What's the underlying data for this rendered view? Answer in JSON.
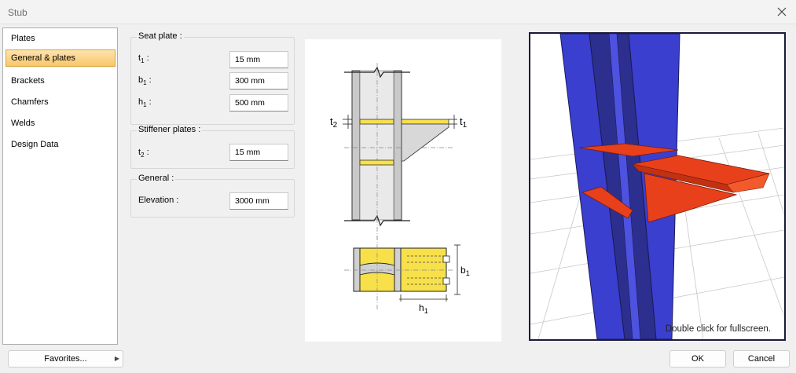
{
  "window": {
    "title": "Stub"
  },
  "sidebar": {
    "items": [
      {
        "label": "Plates"
      },
      {
        "label": "General & plates"
      },
      {
        "label": "Brackets"
      },
      {
        "label": "Chamfers"
      },
      {
        "label": "Welds"
      },
      {
        "label": "Design Data"
      }
    ],
    "active_index": 1
  },
  "seat_plate": {
    "title": "Seat plate :",
    "t1": {
      "sym": "t",
      "sub": "1",
      "colon": " :",
      "value": "15 mm"
    },
    "b1": {
      "sym": "b",
      "sub": "1",
      "colon": " :",
      "value": "300 mm"
    },
    "h1": {
      "sym": "h",
      "sub": "1",
      "colon": " :",
      "value": "500 mm"
    }
  },
  "stiffener_plates": {
    "title": "Stiffener plates :",
    "t2": {
      "sym": "t",
      "sub": "2",
      "colon": " :",
      "value": "15 mm"
    }
  },
  "general": {
    "title": "General :",
    "elevation": {
      "label": "Elevation :",
      "value": "3000 mm"
    }
  },
  "drawing": {
    "t2_sym": "t",
    "t2_sub": "2",
    "t1_sym": "t",
    "t1_sub": "1",
    "b1_sym": "b",
    "b1_sub": "1",
    "h1_sym": "h",
    "h1_sub": "1"
  },
  "view3d": {
    "hint": "Double click for fullscreen."
  },
  "buttons": {
    "favorites": "Favorites...",
    "ok": "OK",
    "cancel": "Cancel"
  },
  "colors": {
    "accent_selected": "#f8c76b",
    "column_blue": "#3a3fcf",
    "plate_orange": "#e8401b",
    "plate_yellow": "#f7e04a"
  }
}
